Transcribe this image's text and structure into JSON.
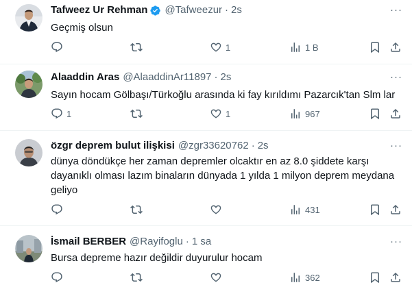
{
  "tweets": [
    {
      "name": "Tafweez Ur Rehman",
      "verified": true,
      "handle": "@Tafweezur",
      "time": "2s",
      "text": "Geçmiş olsun",
      "replies": "",
      "retweets": "",
      "likes": "1",
      "views": "1 B"
    },
    {
      "name": "Alaaddin Aras",
      "verified": false,
      "handle": "@AlaaddinAr11897",
      "time": "2s",
      "text": "Sayın hocam Gölbaşı/Türkoğlu arasında ki fay kırıldımı Pazarcık'tan Slm lar",
      "replies": "1",
      "retweets": "",
      "likes": "1",
      "views": "967"
    },
    {
      "name": "özgr deprem bulut ilişkisi",
      "verified": false,
      "handle": "@zgr33620762",
      "time": "2s",
      "text_lines": [
        "dünya döndükçe her zaman depremler olcaktır en az 8.0 şiddete karşı",
        "dayanıklı olması lazım binaların dünyada 1 yılda 1 milyon deprem meydana",
        "geliyo"
      ],
      "replies": "",
      "retweets": "",
      "likes": "",
      "views": "431"
    },
    {
      "name": "İsmail BERBER",
      "verified": false,
      "handle": "@Rayifoglu",
      "time": "1 sa",
      "text": "Bursa depreme hazır değildir duyurulur hocam",
      "replies": "",
      "retweets": "",
      "likes": "",
      "views": "362"
    }
  ],
  "more_label": "···",
  "separator": "·",
  "colors": {
    "text": "#0f1419",
    "muted": "#536471",
    "verified": "#1d9bf0",
    "border": "#eff3f4"
  }
}
